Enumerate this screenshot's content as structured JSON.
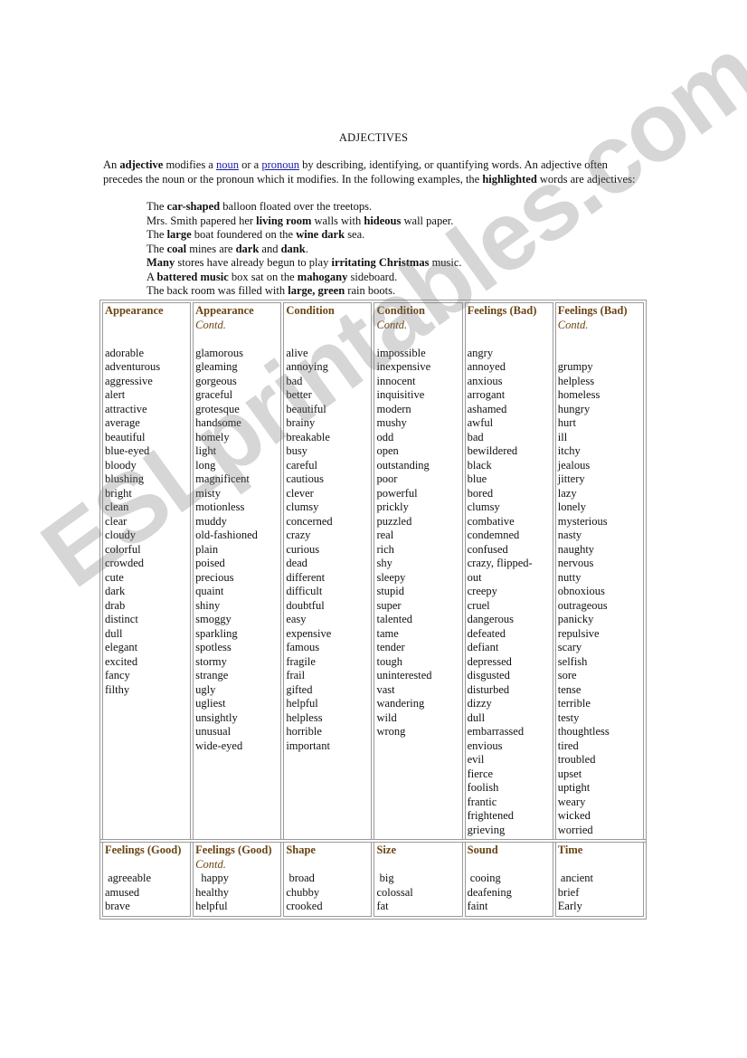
{
  "title": "ADJECTIVES",
  "intro": {
    "p1": "An ",
    "b1": "adjective",
    "p2": " modifies a ",
    "link1": "noun",
    "p3": " or a ",
    "link2": "pronoun",
    "p4": " by describing, identifying, or quantifying words. An adjective often precedes the noun or the pronoun which it modifies.  In the following examples, the ",
    "b2": "highlighted",
    "p5": " words are adjectives:"
  },
  "examples": [
    [
      {
        "t": "The "
      },
      {
        "b": "car-shaped"
      },
      {
        "t": " balloon floated over the treetops."
      }
    ],
    [
      {
        "t": "Mrs. Smith papered her "
      },
      {
        "b": "living room"
      },
      {
        "t": " walls with "
      },
      {
        "b": "hideous"
      },
      {
        "t": " wall paper."
      }
    ],
    [
      {
        "t": "The "
      },
      {
        "b": "large"
      },
      {
        "t": " boat foundered on the "
      },
      {
        "b": "wine dark"
      },
      {
        "t": " sea."
      }
    ],
    [
      {
        "t": "The "
      },
      {
        "b": "coal"
      },
      {
        "t": " mines are "
      },
      {
        "b": "dark"
      },
      {
        "t": " and "
      },
      {
        "b": "dank"
      },
      {
        "t": "."
      }
    ],
    [
      {
        "b": "Many"
      },
      {
        "t": " stores have already begun to play "
      },
      {
        "b": "irritating Christmas"
      },
      {
        "t": " music."
      }
    ],
    [
      {
        "t": "A "
      },
      {
        "b": "battered music"
      },
      {
        "t": " box sat on the "
      },
      {
        "b": "mahogany"
      },
      {
        "t": " sideboard."
      }
    ],
    [
      {
        "t": "The back room was filled with "
      },
      {
        "b": "large, green"
      },
      {
        "t": " rain boots."
      }
    ]
  ],
  "table1": [
    {
      "header": "Appearance",
      "contd": "",
      "words": [
        "adorable",
        "adventurous",
        "aggressive",
        "alert",
        "attractive",
        "average",
        "beautiful",
        "blue-eyed",
        "bloody",
        "blushing",
        "bright",
        "clean",
        "clear",
        "cloudy",
        "colorful",
        "crowded",
        "cute",
        "dark",
        "drab",
        "distinct",
        "dull",
        "elegant",
        "excited",
        "fancy",
        "filthy"
      ]
    },
    {
      "header": "Appearance",
      "contd": "Contd.",
      "words": [
        "glamorous",
        "gleaming",
        "gorgeous",
        "graceful",
        "grotesque",
        "handsome",
        "homely",
        "light",
        "long",
        "magnificent",
        "misty",
        "motionless",
        "muddy",
        "old-fashioned",
        "plain",
        "poised",
        "precious",
        "quaint",
        "shiny",
        "smoggy",
        "sparkling",
        "spotless",
        "stormy",
        "strange",
        "ugly",
        "ugliest",
        "unsightly",
        "unusual",
        "wide-eyed"
      ]
    },
    {
      "header": "Condition",
      "contd": "",
      "words": [
        "alive",
        "annoying",
        "bad",
        "better",
        "beautiful",
        "brainy",
        "breakable",
        "busy",
        "careful",
        "cautious",
        "clever",
        "clumsy",
        "concerned",
        "crazy",
        "curious",
        "dead",
        "different",
        "difficult",
        "doubtful",
        "easy",
        "expensive",
        "famous",
        "fragile",
        "frail",
        "gifted",
        "helpful",
        "helpless",
        "horrible",
        "important"
      ]
    },
    {
      "header": "Condition",
      "contd": "Contd.",
      "words": [
        "impossible",
        "inexpensive",
        "innocent",
        "inquisitive",
        "modern",
        "mushy",
        "odd",
        "open",
        "outstanding",
        "poor",
        "powerful",
        "prickly",
        "puzzled",
        "real",
        "rich",
        "shy",
        "sleepy",
        "stupid",
        "super",
        "talented",
        "tame",
        "tender",
        "tough",
        "uninterested",
        "vast",
        "wandering",
        "wild",
        "wrong"
      ]
    },
    {
      "header": "Feelings (Bad)",
      "contd": "",
      "words": [
        "angry",
        "annoyed",
        "anxious",
        "arrogant",
        "ashamed",
        "awful",
        "bad",
        "bewildered",
        "black",
        "blue",
        "bored",
        "clumsy",
        "combative",
        "condemned",
        "confused",
        "crazy, flipped-",
        "out",
        "creepy",
        "cruel",
        "dangerous",
        "defeated",
        "defiant",
        "depressed",
        "disgusted",
        "disturbed",
        "dizzy",
        "dull",
        "embarrassed",
        "envious",
        "evil",
        "fierce",
        "foolish",
        "frantic",
        "frightened",
        "grieving"
      ]
    },
    {
      "header": "Feelings (Bad)",
      "contd": "Contd.",
      "words": [
        "",
        "grumpy",
        "helpless",
        "homeless",
        "hungry",
        "hurt",
        "ill",
        "itchy",
        "jealous",
        "jittery",
        "lazy",
        "lonely",
        "mysterious",
        "nasty",
        "naughty",
        "nervous",
        "nutty",
        "obnoxious",
        "outrageous",
        "panicky",
        "repulsive",
        "scary",
        "selfish",
        "sore",
        "tense",
        "terrible",
        "testy",
        "thoughtless",
        "tired",
        "troubled",
        "upset",
        "uptight",
        "weary",
        "wicked",
        "worried"
      ]
    }
  ],
  "table2": [
    {
      "header": "Feelings (Good)",
      "contd": "",
      "words": [
        " agreeable",
        "amused",
        "brave"
      ]
    },
    {
      "header": "Feelings (Good)",
      "contd": "Contd.",
      "words": [
        "  happy",
        "healthy",
        "helpful"
      ]
    },
    {
      "header": "Shape",
      "contd": "",
      "words": [
        " broad",
        "chubby",
        "crooked"
      ]
    },
    {
      "header": "Size",
      "contd": "",
      "words": [
        " big",
        "colossal",
        "fat"
      ]
    },
    {
      "header": "Sound",
      "contd": "",
      "words": [
        " cooing",
        "deafening",
        "faint"
      ]
    },
    {
      "header": "Time",
      "contd": "",
      "words": [
        " ancient",
        "brief",
        "Early"
      ]
    }
  ],
  "watermark": "ESLprintables.com",
  "colors": {
    "header": "#6b4413",
    "link": "#1a1aa6",
    "border": "#9a9a9a"
  }
}
